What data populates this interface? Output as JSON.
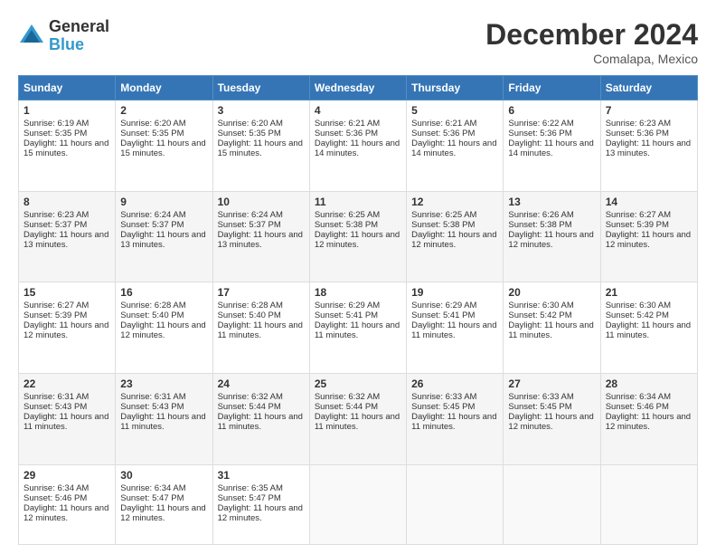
{
  "logo": {
    "general": "General",
    "blue": "Blue"
  },
  "title": "December 2024",
  "subtitle": "Comalapa, Mexico",
  "days_header": [
    "Sunday",
    "Monday",
    "Tuesday",
    "Wednesday",
    "Thursday",
    "Friday",
    "Saturday"
  ],
  "weeks": [
    [
      {
        "day": "1",
        "sunrise": "Sunrise: 6:19 AM",
        "sunset": "Sunset: 5:35 PM",
        "daylight": "Daylight: 11 hours and 15 minutes."
      },
      {
        "day": "2",
        "sunrise": "Sunrise: 6:20 AM",
        "sunset": "Sunset: 5:35 PM",
        "daylight": "Daylight: 11 hours and 15 minutes."
      },
      {
        "day": "3",
        "sunrise": "Sunrise: 6:20 AM",
        "sunset": "Sunset: 5:35 PM",
        "daylight": "Daylight: 11 hours and 15 minutes."
      },
      {
        "day": "4",
        "sunrise": "Sunrise: 6:21 AM",
        "sunset": "Sunset: 5:36 PM",
        "daylight": "Daylight: 11 hours and 14 minutes."
      },
      {
        "day": "5",
        "sunrise": "Sunrise: 6:21 AM",
        "sunset": "Sunset: 5:36 PM",
        "daylight": "Daylight: 11 hours and 14 minutes."
      },
      {
        "day": "6",
        "sunrise": "Sunrise: 6:22 AM",
        "sunset": "Sunset: 5:36 PM",
        "daylight": "Daylight: 11 hours and 14 minutes."
      },
      {
        "day": "7",
        "sunrise": "Sunrise: 6:23 AM",
        "sunset": "Sunset: 5:36 PM",
        "daylight": "Daylight: 11 hours and 13 minutes."
      }
    ],
    [
      {
        "day": "8",
        "sunrise": "Sunrise: 6:23 AM",
        "sunset": "Sunset: 5:37 PM",
        "daylight": "Daylight: 11 hours and 13 minutes."
      },
      {
        "day": "9",
        "sunrise": "Sunrise: 6:24 AM",
        "sunset": "Sunset: 5:37 PM",
        "daylight": "Daylight: 11 hours and 13 minutes."
      },
      {
        "day": "10",
        "sunrise": "Sunrise: 6:24 AM",
        "sunset": "Sunset: 5:37 PM",
        "daylight": "Daylight: 11 hours and 13 minutes."
      },
      {
        "day": "11",
        "sunrise": "Sunrise: 6:25 AM",
        "sunset": "Sunset: 5:38 PM",
        "daylight": "Daylight: 11 hours and 12 minutes."
      },
      {
        "day": "12",
        "sunrise": "Sunrise: 6:25 AM",
        "sunset": "Sunset: 5:38 PM",
        "daylight": "Daylight: 11 hours and 12 minutes."
      },
      {
        "day": "13",
        "sunrise": "Sunrise: 6:26 AM",
        "sunset": "Sunset: 5:38 PM",
        "daylight": "Daylight: 11 hours and 12 minutes."
      },
      {
        "day": "14",
        "sunrise": "Sunrise: 6:27 AM",
        "sunset": "Sunset: 5:39 PM",
        "daylight": "Daylight: 11 hours and 12 minutes."
      }
    ],
    [
      {
        "day": "15",
        "sunrise": "Sunrise: 6:27 AM",
        "sunset": "Sunset: 5:39 PM",
        "daylight": "Daylight: 11 hours and 12 minutes."
      },
      {
        "day": "16",
        "sunrise": "Sunrise: 6:28 AM",
        "sunset": "Sunset: 5:40 PM",
        "daylight": "Daylight: 11 hours and 12 minutes."
      },
      {
        "day": "17",
        "sunrise": "Sunrise: 6:28 AM",
        "sunset": "Sunset: 5:40 PM",
        "daylight": "Daylight: 11 hours and 11 minutes."
      },
      {
        "day": "18",
        "sunrise": "Sunrise: 6:29 AM",
        "sunset": "Sunset: 5:41 PM",
        "daylight": "Daylight: 11 hours and 11 minutes."
      },
      {
        "day": "19",
        "sunrise": "Sunrise: 6:29 AM",
        "sunset": "Sunset: 5:41 PM",
        "daylight": "Daylight: 11 hours and 11 minutes."
      },
      {
        "day": "20",
        "sunrise": "Sunrise: 6:30 AM",
        "sunset": "Sunset: 5:42 PM",
        "daylight": "Daylight: 11 hours and 11 minutes."
      },
      {
        "day": "21",
        "sunrise": "Sunrise: 6:30 AM",
        "sunset": "Sunset: 5:42 PM",
        "daylight": "Daylight: 11 hours and 11 minutes."
      }
    ],
    [
      {
        "day": "22",
        "sunrise": "Sunrise: 6:31 AM",
        "sunset": "Sunset: 5:43 PM",
        "daylight": "Daylight: 11 hours and 11 minutes."
      },
      {
        "day": "23",
        "sunrise": "Sunrise: 6:31 AM",
        "sunset": "Sunset: 5:43 PM",
        "daylight": "Daylight: 11 hours and 11 minutes."
      },
      {
        "day": "24",
        "sunrise": "Sunrise: 6:32 AM",
        "sunset": "Sunset: 5:44 PM",
        "daylight": "Daylight: 11 hours and 11 minutes."
      },
      {
        "day": "25",
        "sunrise": "Sunrise: 6:32 AM",
        "sunset": "Sunset: 5:44 PM",
        "daylight": "Daylight: 11 hours and 11 minutes."
      },
      {
        "day": "26",
        "sunrise": "Sunrise: 6:33 AM",
        "sunset": "Sunset: 5:45 PM",
        "daylight": "Daylight: 11 hours and 11 minutes."
      },
      {
        "day": "27",
        "sunrise": "Sunrise: 6:33 AM",
        "sunset": "Sunset: 5:45 PM",
        "daylight": "Daylight: 11 hours and 12 minutes."
      },
      {
        "day": "28",
        "sunrise": "Sunrise: 6:34 AM",
        "sunset": "Sunset: 5:46 PM",
        "daylight": "Daylight: 11 hours and 12 minutes."
      }
    ],
    [
      {
        "day": "29",
        "sunrise": "Sunrise: 6:34 AM",
        "sunset": "Sunset: 5:46 PM",
        "daylight": "Daylight: 11 hours and 12 minutes."
      },
      {
        "day": "30",
        "sunrise": "Sunrise: 6:34 AM",
        "sunset": "Sunset: 5:47 PM",
        "daylight": "Daylight: 11 hours and 12 minutes."
      },
      {
        "day": "31",
        "sunrise": "Sunrise: 6:35 AM",
        "sunset": "Sunset: 5:47 PM",
        "daylight": "Daylight: 11 hours and 12 minutes."
      },
      null,
      null,
      null,
      null
    ]
  ]
}
